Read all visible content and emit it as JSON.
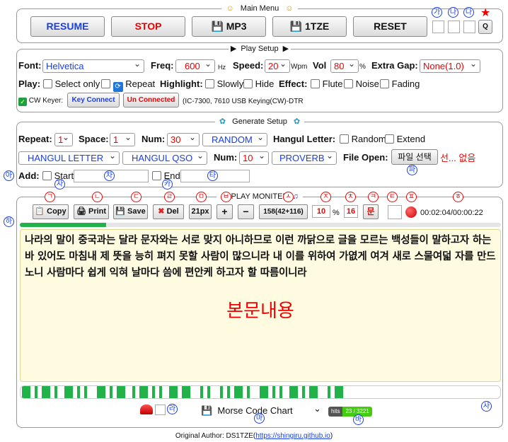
{
  "main_menu": {
    "legend": "Main Menu",
    "buttons": {
      "resume": "RESUME",
      "stop": "STOP",
      "mp3": "MP3",
      "tze": "1TZE",
      "reset": "RESET"
    },
    "q_label": "Q",
    "markers": [
      "가",
      "나",
      "다"
    ]
  },
  "play_setup": {
    "legend": "Play Setup",
    "font": {
      "label": "Font:",
      "value": "Helvetica"
    },
    "freq": {
      "label": "Freq:",
      "value": "600",
      "unit": "Hz"
    },
    "speed": {
      "label": "Speed:",
      "value": "20",
      "unit": "Wpm"
    },
    "vol": {
      "label": "Vol",
      "value": "80",
      "unit": "%"
    },
    "extra_gap": {
      "label": "Extra Gap:",
      "value": "None(1.0)"
    },
    "play_label": "Play:",
    "select_only": "Select only",
    "repeat": "Repeat",
    "highlight_label": "Highlight:",
    "slowly": "Slowly",
    "hide": "Hide",
    "effect_label": "Effect:",
    "flute": "Flute",
    "noise": "Noise",
    "fading": "Fading",
    "cw_keyer": "CW Keyer:",
    "key_connect": "Key Connect",
    "un_connected": "Un Connected",
    "keyer_model": "(IC-7300, 7610 USB Keying(CW)-DTR"
  },
  "generate_setup": {
    "legend": "Generate Setup",
    "repeat": {
      "label": "Repeat:",
      "value": "1"
    },
    "space": {
      "label": "Space:",
      "value": "1"
    },
    "num": {
      "label": "Num:",
      "value": "30"
    },
    "mode": "RANDOM",
    "hangul_letter_label": "Hangul Letter:",
    "random": "Random",
    "extend": "Extend",
    "sel_letter": "HANGUL LETTER",
    "sel_qso": "HANGUL QSO",
    "num2": {
      "label": "Num:",
      "value": "10"
    },
    "sel_proverb": "PROVERB",
    "file_open_label": "File Open:",
    "file_button": "파일 선택",
    "file_status": "선... 없음",
    "add_label": "Add:",
    "start": "Start",
    "end": "End",
    "markers": [
      "아",
      "자",
      "차",
      "카",
      "타",
      "파"
    ]
  },
  "play_monitor": {
    "legend": "PLAY MONITER",
    "toolbar": {
      "copy": "Copy",
      "print": "Print",
      "save": "Save",
      "del": "Del",
      "font_size": "21px",
      "plus": "+",
      "minus": "−",
      "count": "158(42+116)",
      "percent": "10",
      "percent_unit": "%",
      "num": "16",
      "mun": "문",
      "timer": "00:02:04/00:00:22"
    },
    "toolbar_markers": [
      "ㄱ",
      "ㄴ",
      "ㄷ",
      "ㄹ",
      "ㅁ",
      "ㅂ",
      "ㅅ",
      "ㅈ",
      "ㅊ",
      "ㅋ",
      "ㅌ",
      "ㅍ",
      "ㅎ"
    ],
    "progress": 0.18,
    "text": "나라의 말이 중국과는 달라 문자와는 서로 맞지 아니하므로 이런 까닭으로 글을 모르는 백성들이 말하고자 하는 바 있어도 마침내 제 뜻을 능히 펴지 못할 사람이 많으니라 내 이를 위하여 가엾게 여겨 새로 스물여덟 자를 만드노니 사람마다 쉽게 익혀 날마다 씀에 편안케 하고자 할 따름이니라",
    "content_label": "본문내용",
    "side_marker": "하",
    "morse_chart": "Morse Code Chart",
    "hits_label": "hits",
    "hits_value": "23 / 3221",
    "bottom_markers": [
      "라",
      "마",
      "바",
      "사"
    ]
  },
  "footer": {
    "author_prefix": "Original Author: DS1TZE(",
    "link": "https://shingiru.github.io",
    "author_suffix": ")"
  },
  "colors": {
    "accent_blue": "#1a40e0",
    "accent_red": "#e00000",
    "text_bg": "#fffbe0",
    "progress_green": "#21b34a"
  }
}
